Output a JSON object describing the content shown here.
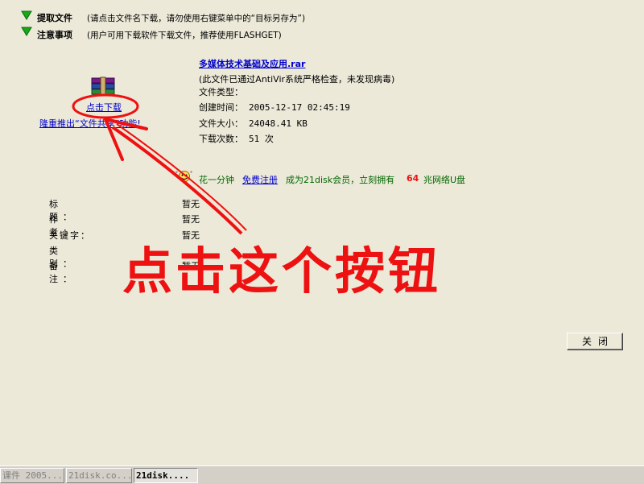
{
  "header": {
    "extract_title": "提取文件",
    "extract_hint": "(请点击文件名下载，请勿使用右键菜单中的“目标另存为”)",
    "notice_title": "注意事项",
    "notice_hint": "(用户可用下载软件下载文件，推荐使用FLASHGET)"
  },
  "download": {
    "link_label": "点击下载",
    "promo_link": "隆重推出“文件共享”功能!"
  },
  "file": {
    "name": "多媒体技术基础及应用.rar",
    "scan_note": "(此文件已通过AntiVir系统严格检查，未发现病毒)",
    "type_label": "文件类型：",
    "type_value": "",
    "created_label": "创建时间：",
    "created_value": "2005-12-17 02:45:19",
    "size_label": "文件大小：",
    "size_value": "24048.41 KB",
    "downloads_label": "下载次数：",
    "downloads_value": "51 次"
  },
  "promo": {
    "prefix": "花一分钟",
    "register_link": "免费注册",
    "middle": "成为21disk会员，立刻拥有",
    "amount": "64",
    "suffix": "兆网络U盘"
  },
  "meta": [
    {
      "label": "标 题：",
      "value": "暂无"
    },
    {
      "label": "作 者：",
      "value": "暂无"
    },
    {
      "label": "关键字：",
      "value": "暂无"
    },
    {
      "label": "类 别：",
      "value": ""
    },
    {
      "label": "备 注：",
      "value": "暂无"
    }
  ],
  "buttons": {
    "close": "关闭"
  },
  "annotation": {
    "text": "点击这个按钮"
  },
  "taskbar": [
    {
      "label": "课件 2005..."
    },
    {
      "label": "21disk.co..."
    },
    {
      "label": "21disk...."
    }
  ],
  "colors": {
    "accent_red": "#ee1111",
    "link": "#0000cc",
    "green_text": "#006600"
  }
}
